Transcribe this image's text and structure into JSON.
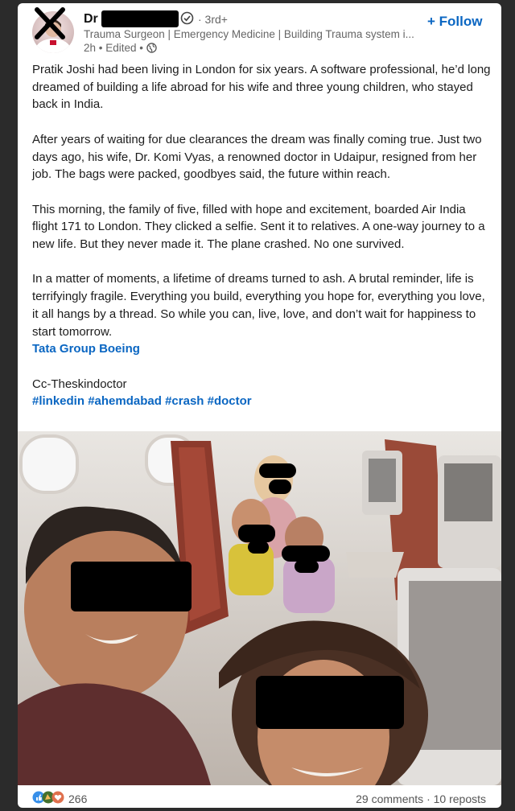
{
  "post": {
    "author": {
      "name_visible": "Dr",
      "degree": "· 3rd+",
      "headline": "Trauma Surgeon | Emergency Medicine | Building Trauma system i...",
      "time": "2h",
      "edited": "• Edited •"
    },
    "follow_label": "+ Follow",
    "paragraphs": [
      "Pratik Joshi had been living in London for six years. A software professional, he’d long dreamed of building a life abroad for his wife and three young children, who stayed back in India.",
      "After years of waiting for due clearances the dream was finally coming true. Just two days ago, his wife, Dr. Komi Vyas, a renowned doctor in Udaipur, resigned from her job. The bags were packed, goodbyes said, the future within reach.",
      "This morning, the family of five, filled with hope and excitement, boarded Air India flight 171 to London. They clicked a selfie. Sent it to relatives. A one-way journey to a new life. But they never made it. The plane crashed. No one survived.",
      "In a matter of moments, a lifetime of dreams turned to ash. A brutal reminder, life is terrifyingly fragile. Everything you build, everything you hope for, everything you love, it all hangs by a thread. So while you can, live, love, and don’t wait for happiness to start tomorrow."
    ],
    "mentions": [
      "Tata Group",
      "Boeing"
    ],
    "credit": "Cc-Theskindoctor",
    "hashtags": [
      "#linkedin",
      "#ahemdabad",
      "#crash",
      "#doctor"
    ],
    "reaction_count": "266",
    "comments": "29 comments",
    "separator": "·",
    "reposts": "10 reposts"
  },
  "colors": {
    "link": "#0a66c2",
    "text": "#1c1c1c",
    "muted": "#666666",
    "background": "#2b2b2b"
  },
  "icons": [
    "verified-shield-icon",
    "globe-icon",
    "like-reaction-icon",
    "celebrate-reaction-icon",
    "love-reaction-icon"
  ]
}
